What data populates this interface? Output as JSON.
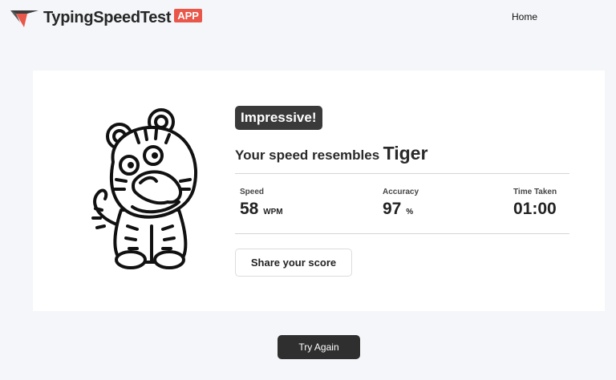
{
  "header": {
    "brand_name": "TypingSpeedTest",
    "brand_badge": "APP",
    "nav_home": "Home"
  },
  "result": {
    "badge": "Impressive!",
    "resembles_lead": "Your speed resembles",
    "animal": "Tiger",
    "stats": [
      {
        "label": "Speed",
        "value": "58",
        "unit": "WPM"
      },
      {
        "label": "Accuracy",
        "value": "97",
        "unit": "%"
      },
      {
        "label": "Time Taken",
        "value": "01:00",
        "unit": ""
      }
    ],
    "share_label": "Share your score"
  },
  "actions": {
    "try_again_label": "Try Again"
  },
  "colors": {
    "page_background": "#f4f6f9",
    "badge_background": "#3a3a3a",
    "brand_accent": "#e9564a",
    "try_again_background": "#2f2f2f"
  },
  "icons": {
    "logo": "brand-logo-icon",
    "result_image": "tiger-illustration"
  }
}
